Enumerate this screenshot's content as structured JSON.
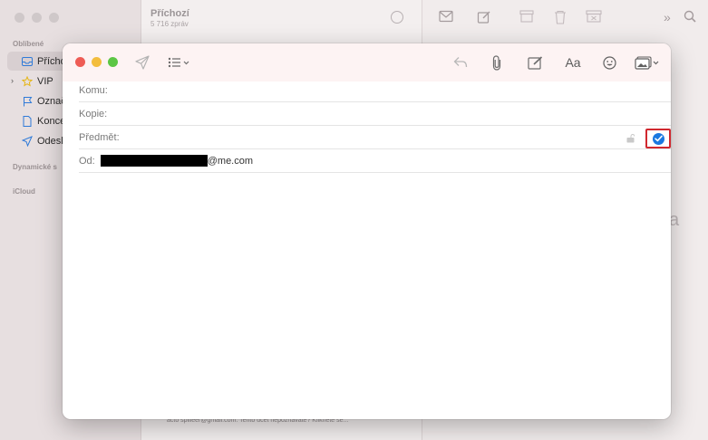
{
  "background_app": {
    "sidebar": {
      "sections": {
        "favorites": "Oblíbené",
        "dynamic": "Dynamické s",
        "icloud": "iCloud"
      },
      "items": [
        {
          "label": "Přícho",
          "icon": "inbox-icon",
          "selected": true
        },
        {
          "label": "VIP",
          "icon": "star-icon",
          "selected": false
        },
        {
          "label": "Označ",
          "icon": "flag-icon",
          "selected": false
        },
        {
          "label": "Konce",
          "icon": "document-icon",
          "selected": false
        },
        {
          "label": "Odesla",
          "icon": "paper-plane-icon",
          "selected": false
        }
      ]
    },
    "message_list": {
      "title": "Příchozí",
      "subtitle": "5 716 zpráv",
      "snippet": "acto spilleer@gmail.com. Tento účet nepoznáváte? Klikněte se..."
    },
    "reading_pane_letter": "a"
  },
  "compose": {
    "fields": {
      "to_label": "Komu:",
      "cc_label": "Kopie:",
      "subject_label": "Předmět:",
      "from_label": "Od:",
      "from_value_suffix": "@me.com"
    },
    "toolbar": {
      "format_label": "Aa"
    },
    "colors": {
      "accent": "#1a78e0",
      "highlight_box": "#d0282f"
    }
  }
}
